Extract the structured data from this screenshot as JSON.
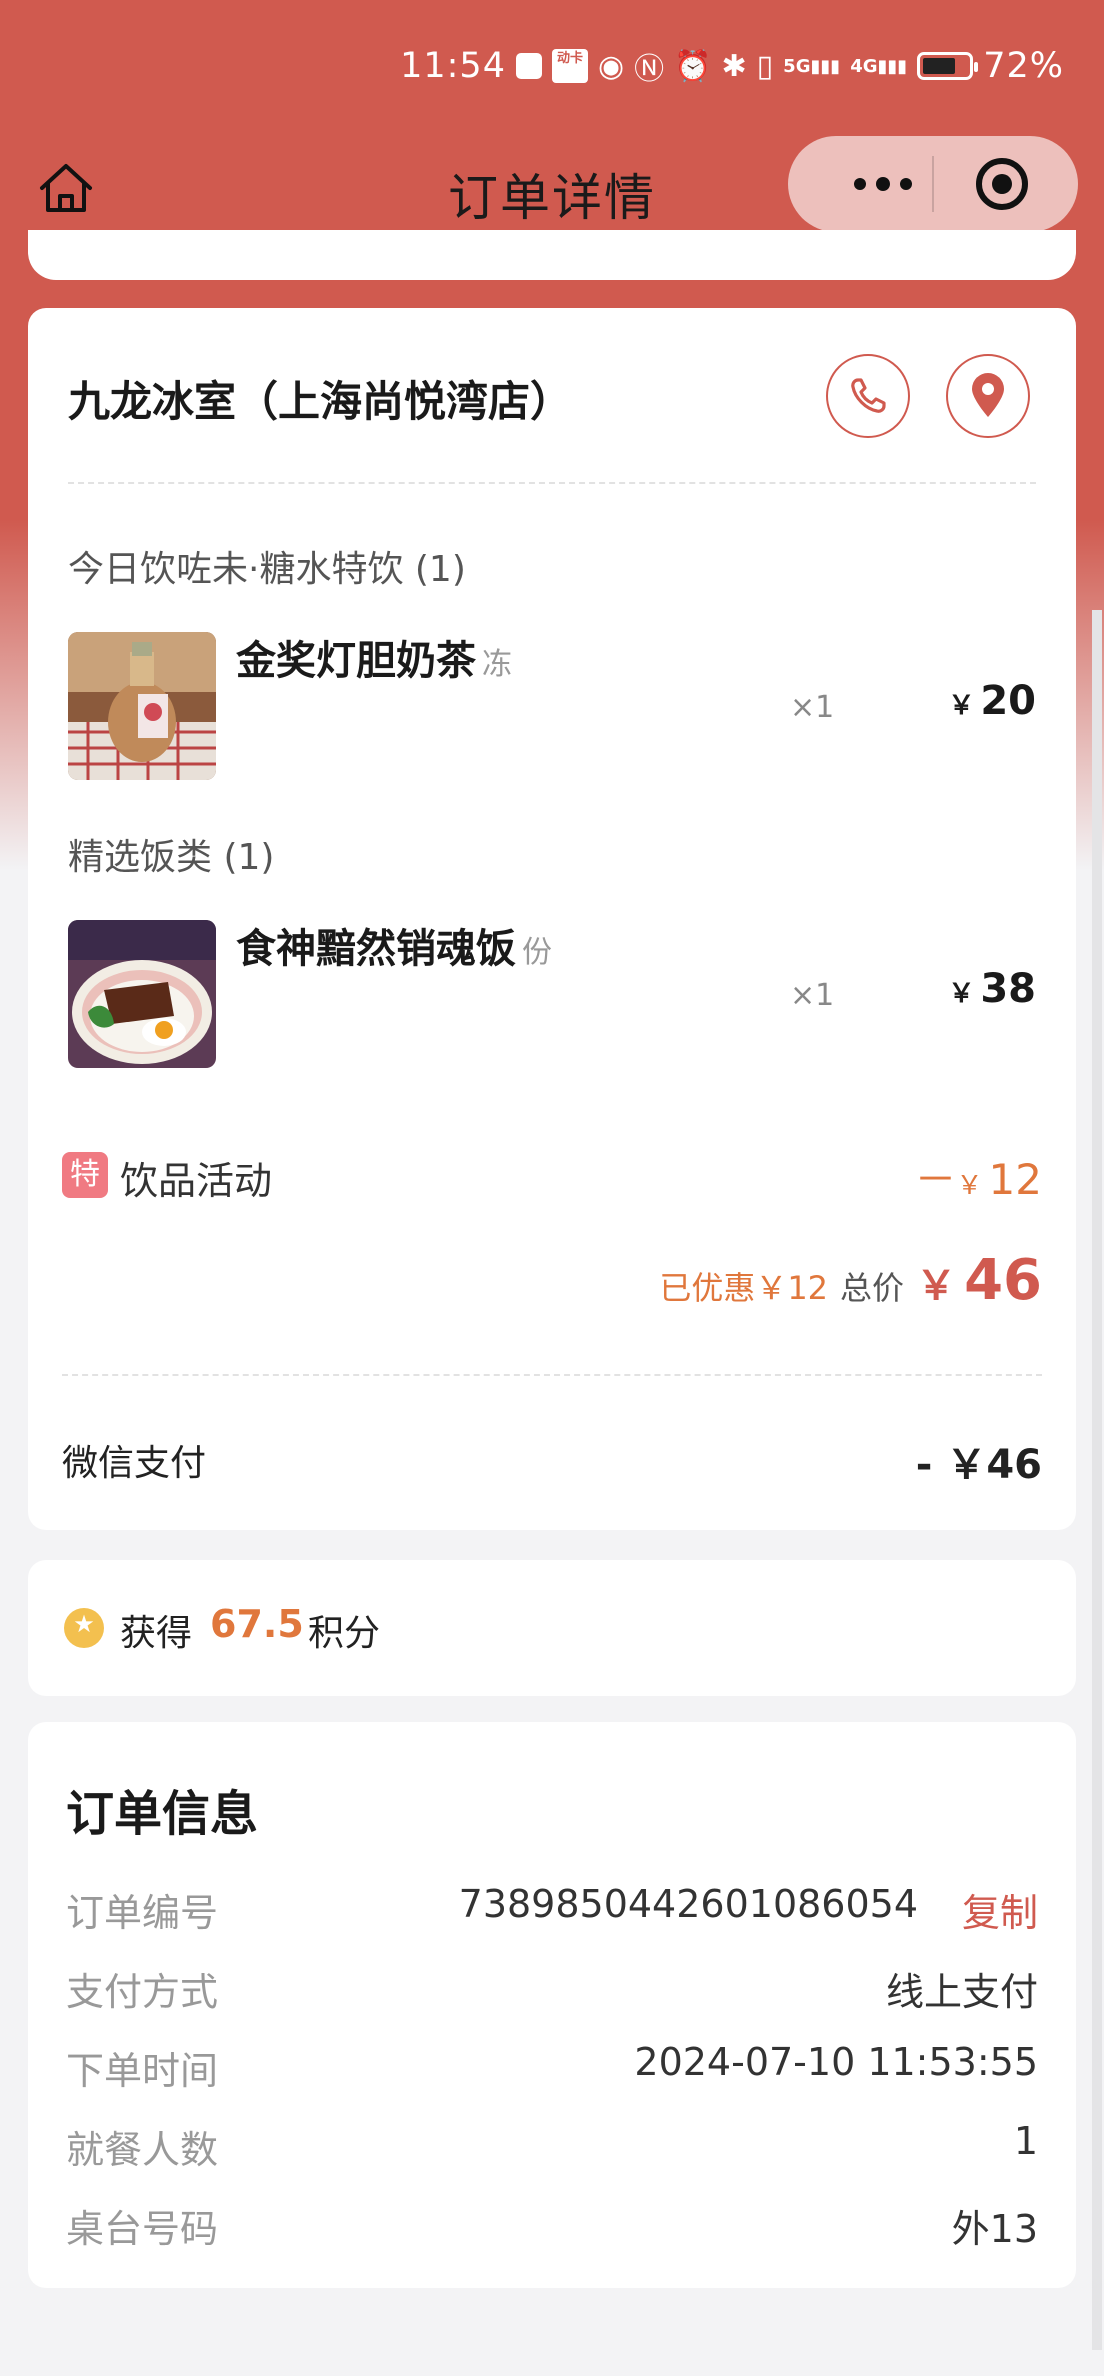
{
  "status_bar": {
    "time": "11:54",
    "app_badge": "动卡",
    "battery": "72%"
  },
  "nav": {
    "title": "订单详情"
  },
  "store": {
    "name": "九龙冰室（上海尚悦湾店）"
  },
  "groups": [
    {
      "title": "今日饮咗未·糖水特饮 (1)",
      "item": {
        "name": "金奖灯胆奶茶",
        "unit": "冻",
        "qty": "×1",
        "price": "20"
      }
    },
    {
      "title": "精选饭类 (1)",
      "item": {
        "name": "食神黯然销魂饭",
        "unit": "份",
        "qty": "×1",
        "price": "38"
      }
    }
  ],
  "promo": {
    "badge": "特",
    "label": "饮品活动",
    "amount_prefix": "－",
    "amount": "12"
  },
  "totals": {
    "saved": "已优惠￥12",
    "label": "总价",
    "value": "46"
  },
  "payment": {
    "label": "微信支付",
    "value": "- ￥46"
  },
  "points": {
    "prefix": "获得",
    "value": "67.5",
    "suffix": "积分"
  },
  "order_info": {
    "title": "订单信息",
    "copy_label": "复制",
    "rows": [
      {
        "key": "订单编号",
        "value": "7389850442601086054"
      },
      {
        "key": "支付方式",
        "value": "线上支付"
      },
      {
        "key": "下单时间",
        "value": "2024-07-10 11:53:55"
      },
      {
        "key": "就餐人数",
        "value": "1"
      },
      {
        "key": "桌台号码",
        "value": "外13"
      }
    ]
  },
  "currency": "￥",
  "colors": {
    "brand": "#d05a4f",
    "accent_orange": "#e0773c",
    "promo_badge": "#f07a82",
    "points_coin": "#f3c04f"
  }
}
